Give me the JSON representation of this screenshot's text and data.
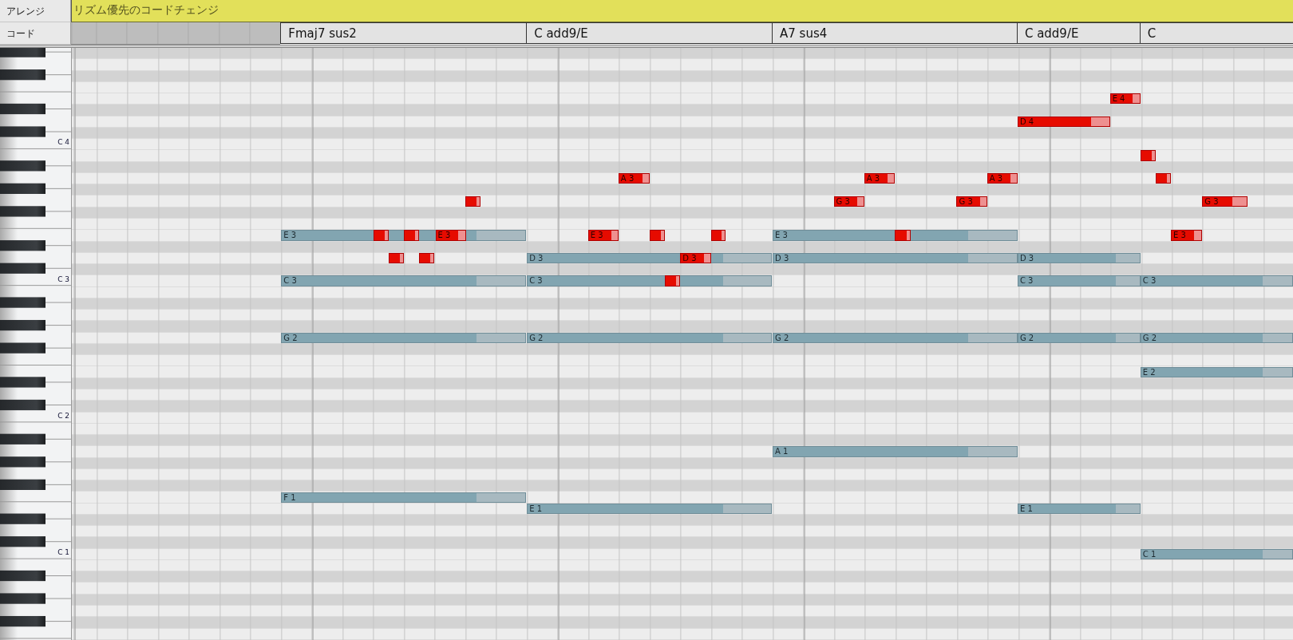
{
  "tracks": {
    "arrange_label": "アレンジ",
    "arrange_section": "リズム優先のコードチェンジ",
    "chord_label": "コード"
  },
  "chords": [
    {
      "name": "Fmaj7 sus2"
    },
    {
      "name": "C add9/E"
    },
    {
      "name": "A7 sus4"
    },
    {
      "name": "C add9/E"
    },
    {
      "name": "C"
    }
  ],
  "keyboard": {
    "octave_labels": [
      "C 4",
      "C 3",
      "C 2",
      "C 1"
    ]
  },
  "notes": [
    {
      "kind": "chord",
      "label": "E 3"
    },
    {
      "kind": "chord",
      "label": "C 3"
    },
    {
      "kind": "chord",
      "label": "G 2"
    },
    {
      "kind": "chord",
      "label": "F 1"
    },
    {
      "kind": "chord",
      "label": "D 3"
    },
    {
      "kind": "chord",
      "label": "C 3"
    },
    {
      "kind": "chord",
      "label": "G 2"
    },
    {
      "kind": "chord",
      "label": "E 1"
    },
    {
      "kind": "chord",
      "label": "E 3"
    },
    {
      "kind": "chord",
      "label": "D 3"
    },
    {
      "kind": "chord",
      "label": "G 2"
    },
    {
      "kind": "chord",
      "label": "A 1"
    },
    {
      "kind": "chord",
      "label": "D 3"
    },
    {
      "kind": "chord",
      "label": "C 3"
    },
    {
      "kind": "chord",
      "label": "G 2"
    },
    {
      "kind": "chord",
      "label": "E 1"
    },
    {
      "kind": "chord",
      "label": "C 3"
    },
    {
      "kind": "chord",
      "label": "G 2"
    },
    {
      "kind": "chord",
      "label": "E 2"
    },
    {
      "kind": "chord",
      "label": "C 1"
    },
    {
      "kind": "melody"
    },
    {
      "kind": "melody"
    },
    {
      "kind": "melody"
    },
    {
      "kind": "melody"
    },
    {
      "kind": "melody",
      "label": "E 3"
    },
    {
      "kind": "melody"
    },
    {
      "kind": "melody",
      "label": "E 3"
    },
    {
      "kind": "melody",
      "label": "A 3"
    },
    {
      "kind": "melody"
    },
    {
      "kind": "melody"
    },
    {
      "kind": "melody",
      "label": "D 3"
    },
    {
      "kind": "melody"
    },
    {
      "kind": "melody",
      "label": "G 3"
    },
    {
      "kind": "melody",
      "label": "A 3"
    },
    {
      "kind": "melody"
    },
    {
      "kind": "melody",
      "label": "G 3"
    },
    {
      "kind": "melody",
      "label": "A 3"
    },
    {
      "kind": "melody",
      "label": "D 4"
    },
    {
      "kind": "melody",
      "label": "E 4"
    },
    {
      "kind": "melody"
    },
    {
      "kind": "melody"
    },
    {
      "kind": "melody",
      "label": "E 3"
    },
    {
      "kind": "melody",
      "label": "G 3"
    }
  ]
}
